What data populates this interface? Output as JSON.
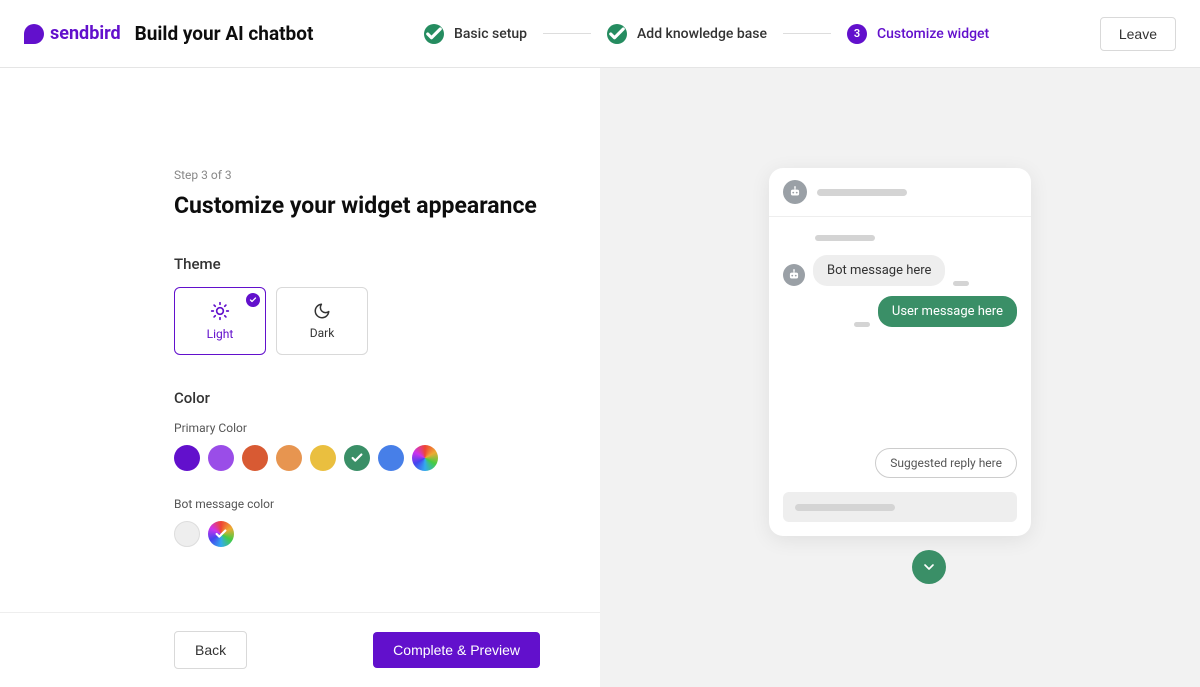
{
  "header": {
    "brand": "sendbird",
    "title": "Build your AI chatbot",
    "leave_label": "Leave"
  },
  "stepper": {
    "steps": [
      {
        "label": "Basic setup",
        "state": "done"
      },
      {
        "label": "Add knowledge base",
        "state": "done"
      },
      {
        "label": "Customize widget",
        "state": "current",
        "number": "3"
      }
    ]
  },
  "page": {
    "step_indicator": "Step 3 of 3",
    "heading": "Customize your widget appearance"
  },
  "theme": {
    "label": "Theme",
    "options": [
      {
        "key": "light",
        "label": "Light",
        "selected": true
      },
      {
        "key": "dark",
        "label": "Dark",
        "selected": false
      }
    ]
  },
  "color": {
    "label": "Color",
    "primary": {
      "label": "Primary Color",
      "swatches": [
        {
          "color": "#6210cc",
          "selected": false
        },
        {
          "color": "#9a4de8",
          "selected": false
        },
        {
          "color": "#d85a33",
          "selected": false
        },
        {
          "color": "#e79550",
          "selected": false
        },
        {
          "color": "#eabf3f",
          "selected": false
        },
        {
          "color": "#3a8f67",
          "selected": true
        },
        {
          "color": "#477fe8",
          "selected": false
        },
        {
          "color": "rainbow",
          "selected": false
        }
      ]
    },
    "bot_message": {
      "label": "Bot message color",
      "swatches": [
        {
          "color": "#eeeeee",
          "selected": false
        },
        {
          "color": "rainbow",
          "selected": true
        }
      ]
    }
  },
  "footer": {
    "back_label": "Back",
    "next_label": "Complete & Preview"
  },
  "preview": {
    "bot_message": "Bot message here",
    "user_message": "User message here",
    "suggested_reply": "Suggested reply here",
    "accent_color": "#3a8f67"
  }
}
